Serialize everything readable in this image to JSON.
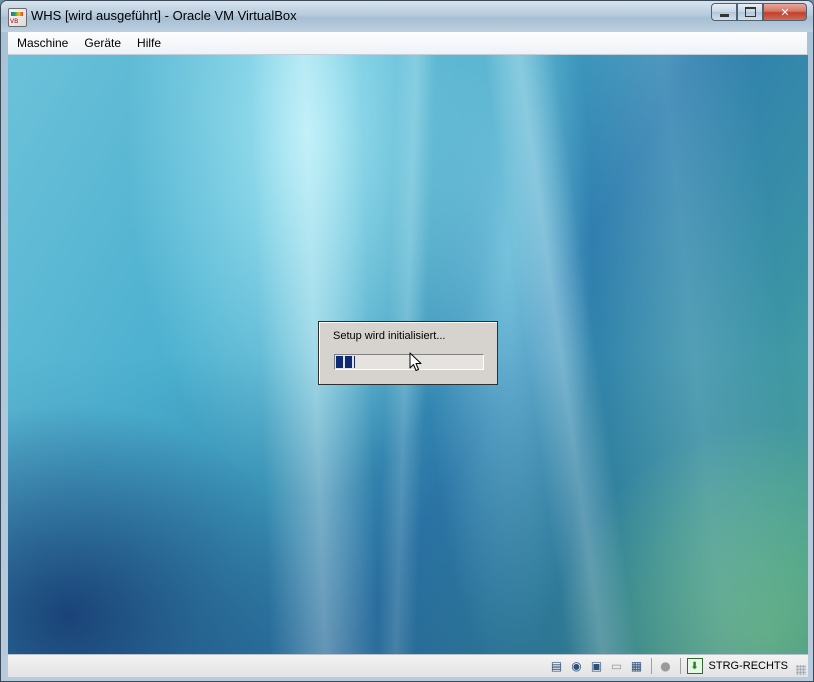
{
  "window": {
    "title": "WHS [wird ausgeführt] - Oracle VM VirtualBox",
    "app_icon": "virtualbox-icon",
    "controls": {
      "minimize_icon": "minimize-icon",
      "maximize_icon": "maximize-icon",
      "close_icon": "close-icon",
      "close_glyph": "✕"
    }
  },
  "menubar": {
    "items": [
      {
        "label": "Maschine"
      },
      {
        "label": "Geräte"
      },
      {
        "label": "Hilfe"
      }
    ]
  },
  "guest": {
    "dialog": {
      "message": "Setup wird initialisiert...",
      "progress": 0.13
    }
  },
  "statusbar": {
    "icons": [
      {
        "name": "hard-disk-icon",
        "glyph": "▤"
      },
      {
        "name": "optical-drive-icon",
        "glyph": "◉"
      },
      {
        "name": "network-icon",
        "glyph": "▣"
      },
      {
        "name": "shared-folders-icon",
        "glyph": "▭"
      },
      {
        "name": "virtualization-icon",
        "glyph": "▦"
      }
    ],
    "mouse_integration_icon": {
      "name": "mouse-integration-icon",
      "glyph": "●"
    },
    "host_key_icon": {
      "name": "host-key-icon",
      "glyph": "⬇"
    },
    "host_key_label": "STRG-RECHTS"
  },
  "colors": {
    "progress_fill": "#0d2a74",
    "dialog_bg": "#d6d3ce"
  }
}
